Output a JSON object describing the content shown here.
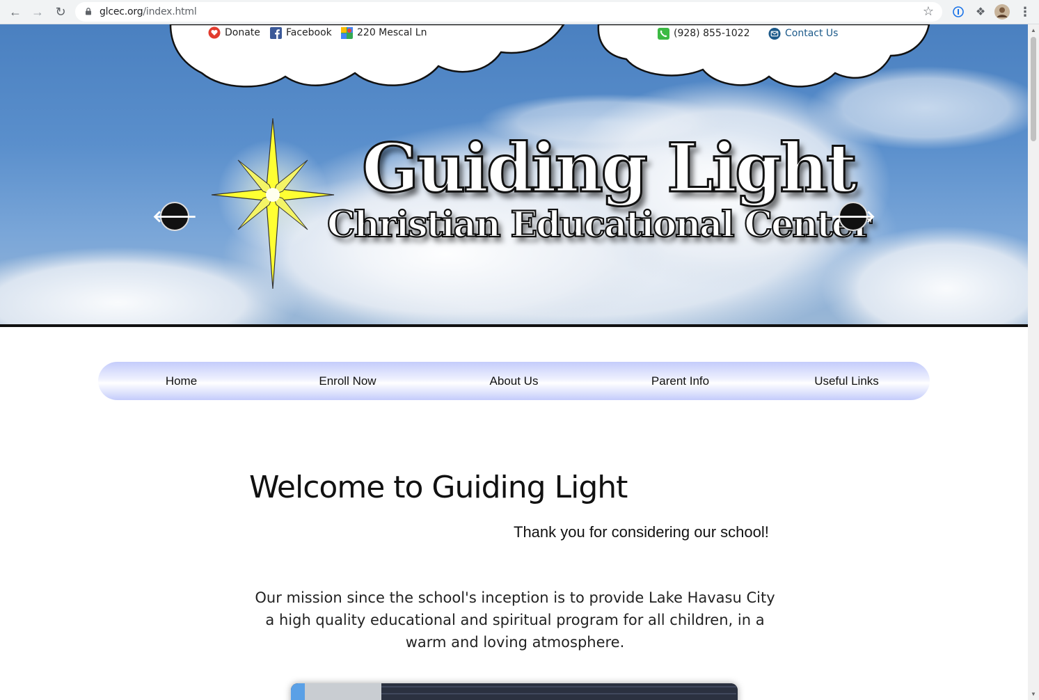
{
  "browser": {
    "url_host": "glcec.org",
    "url_path": "/index.html",
    "icons": {
      "back": "back-arrow-icon",
      "forward": "forward-arrow-icon",
      "reload": "reload-icon",
      "lock": "lock-icon",
      "star": "bookmark-star-icon",
      "password_manager": "password-manager-icon",
      "extensions": "puzzle-icon",
      "profile": "avatar",
      "menu": "kebab-menu-icon"
    }
  },
  "topbar": {
    "donate": "Donate",
    "facebook": "Facebook",
    "address": "220 Mescal Ln",
    "phone": "(928) 855-1022",
    "contact": "Contact Us"
  },
  "hero": {
    "title": "Guiding Light",
    "subtitle": "Christian Educational Center",
    "prev_label": "🡐",
    "next_label": "🡒"
  },
  "nav": {
    "items": [
      {
        "label": "Home"
      },
      {
        "label": "Enroll Now"
      },
      {
        "label": "About Us"
      },
      {
        "label": "Parent Info"
      },
      {
        "label": "Useful Links"
      }
    ]
  },
  "content": {
    "heading": "Welcome to Guiding Light",
    "tagline": "Thank you for considering our school!",
    "mission": "Our mission since the school's inception is to provide Lake Havasu City a high quality educational and spiritual program for all children, in a warm and loving atmosphere."
  },
  "colors": {
    "sky": "#4a80c0",
    "nav_gradient": "#c4ccfb",
    "text": "#111111"
  }
}
